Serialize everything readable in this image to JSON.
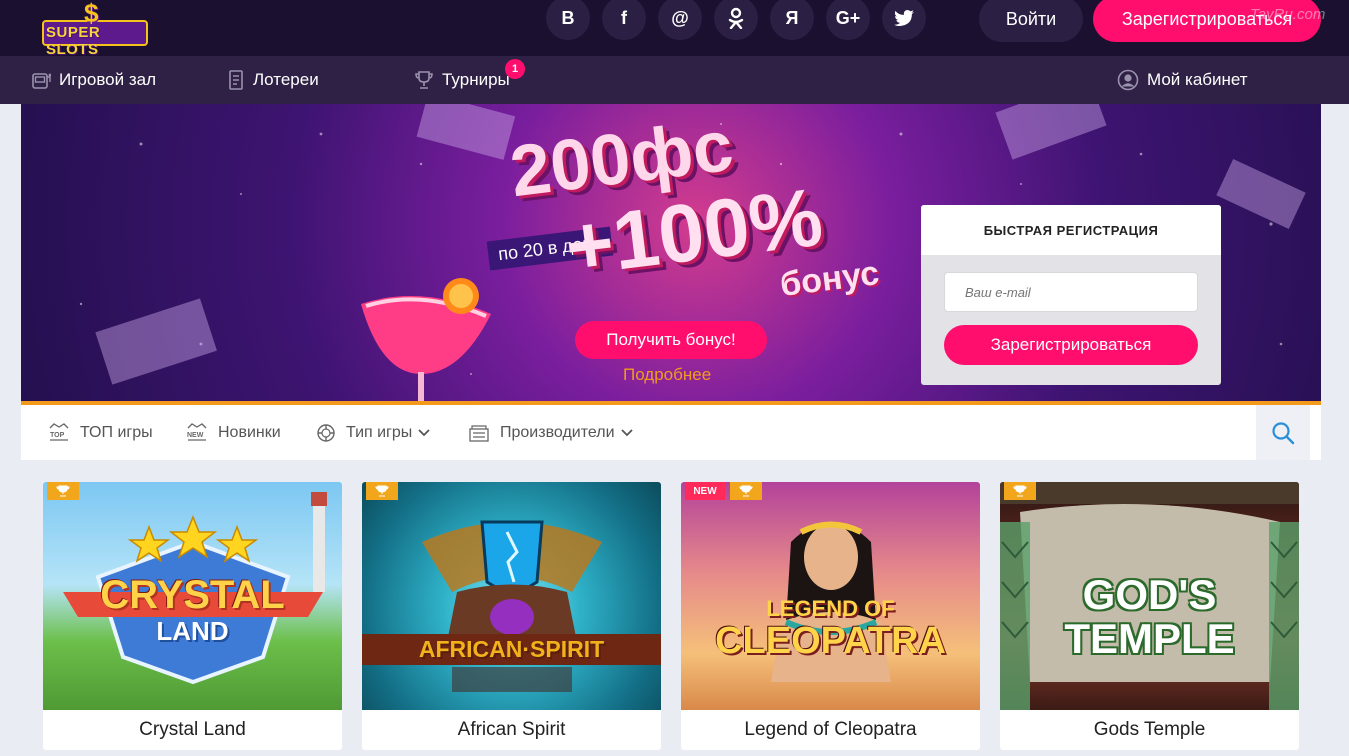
{
  "header": {
    "logo_text": "SUPER SLOTS",
    "logo_symbol": "$",
    "social": [
      {
        "label": "B",
        "icon": "vk-icon"
      },
      {
        "label": "f",
        "icon": "facebook-icon"
      },
      {
        "label": "@",
        "icon": "mailru-icon"
      },
      {
        "label": "ok",
        "icon": "odnoklassniki-icon"
      },
      {
        "label": "Я",
        "icon": "yandex-icon"
      },
      {
        "label": "G+",
        "icon": "googleplus-icon"
      },
      {
        "label": "",
        "icon": "twitter-icon"
      }
    ],
    "login_label": "Войти",
    "register_label": "Зарегистрироваться",
    "watermark": "TayRu.com"
  },
  "nav": {
    "hall": "Игровой зал",
    "lotteries": "Лотереи",
    "tournaments": "Турниры",
    "tournaments_badge": "1",
    "cabinet": "Мой кабинет"
  },
  "banner": {
    "line1": "200фс",
    "sub": "по 20 в день",
    "line2": "+100%",
    "bonus_word": "бонус",
    "cta_label": "Получить бонус!",
    "more_label": "Подробнее",
    "accent_color": "#f39a1d"
  },
  "quick_reg": {
    "title": "БЫСТРАЯ РЕГИСТРАЦИЯ",
    "email_placeholder": "Ваш e-mail",
    "button_label": "Зарегистрироваться"
  },
  "filters": {
    "top": "ТОП игры",
    "new": "Новинки",
    "type": "Тип игры",
    "providers": "Производители"
  },
  "games": [
    {
      "title": "Crystal Land",
      "logo_line1": "CRYSTAL",
      "logo_line2": "LAND",
      "is_new": false,
      "trophy": true
    },
    {
      "title": "African Spirit",
      "logo_line1": "AFRICAN·SPIRIT",
      "logo_line2": "",
      "is_new": false,
      "trophy": true
    },
    {
      "title": "Legend of Cleopatra",
      "logo_line1": "LEGEND OF",
      "logo_line2": "CLEOPATRA",
      "is_new": true,
      "new_label": "NEW",
      "trophy": true
    },
    {
      "title": "Gods Temple",
      "logo_line1": "GOD'S",
      "logo_line2": "TEMPLE",
      "is_new": false,
      "trophy": true
    }
  ],
  "colors": {
    "primary_pink": "#ff0e6e",
    "header_bg": "#1b1030",
    "nav_bg": "#2f2145",
    "trophy_tag": "#f2a61c"
  }
}
